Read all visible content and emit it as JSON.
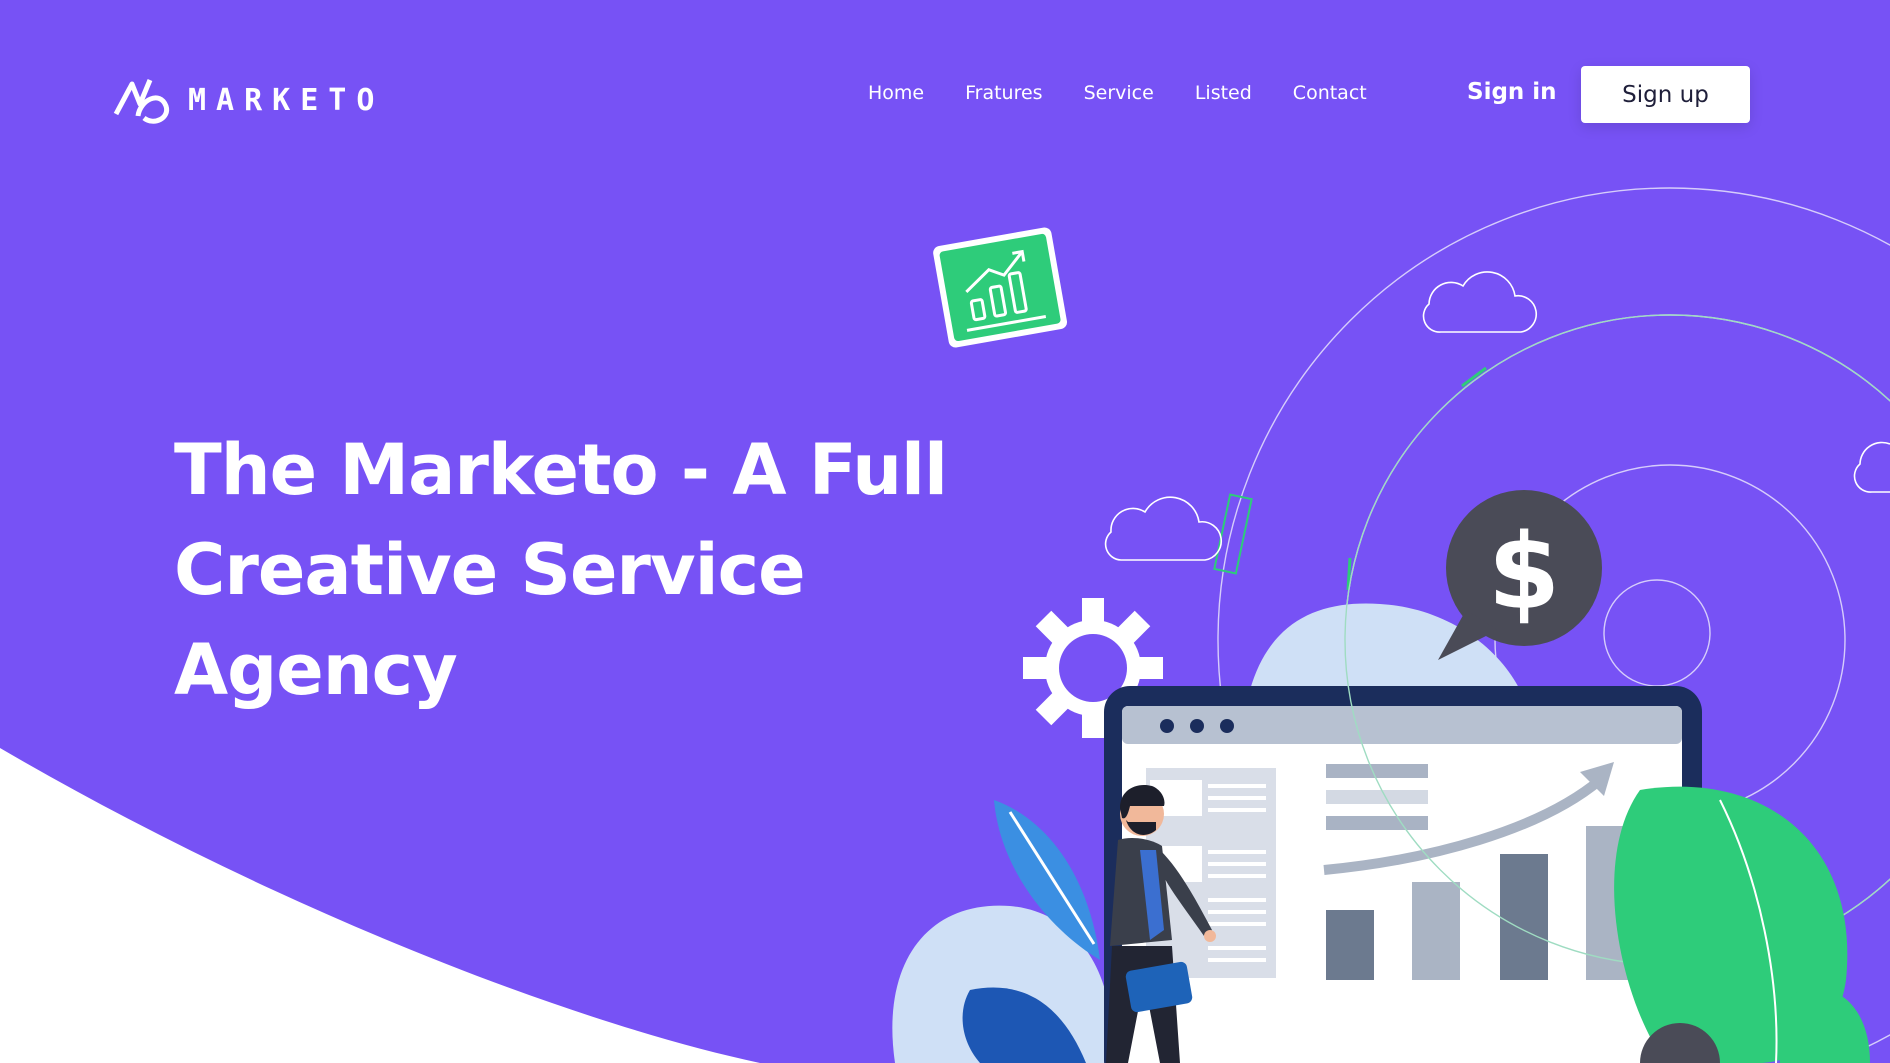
{
  "brand": {
    "name": "MARKETO",
    "logo_icon": "marketo-logo-icon"
  },
  "nav": {
    "links": [
      {
        "label": "Home"
      },
      {
        "label": "Fratures"
      },
      {
        "label": "Service"
      },
      {
        "label": "Listed"
      },
      {
        "label": "Contact"
      }
    ]
  },
  "auth": {
    "signin_label": "Sign in",
    "signup_label": "Sign up"
  },
  "hero": {
    "title_lines": [
      "The Marketo - A Full",
      "Creative Service",
      "Agency"
    ]
  },
  "illustration": {
    "currency_symbol": "$",
    "icons": [
      "chart-card-icon",
      "dollar-bubble-icon",
      "gear-icon",
      "cloud-icon",
      "leaf-icon",
      "businessman-figure",
      "dashboard-screen"
    ]
  },
  "colors": {
    "background": "#7752f5",
    "accent_green": "#2ecc7a",
    "dark_navy": "#1b2d5c",
    "white": "#ffffff"
  }
}
